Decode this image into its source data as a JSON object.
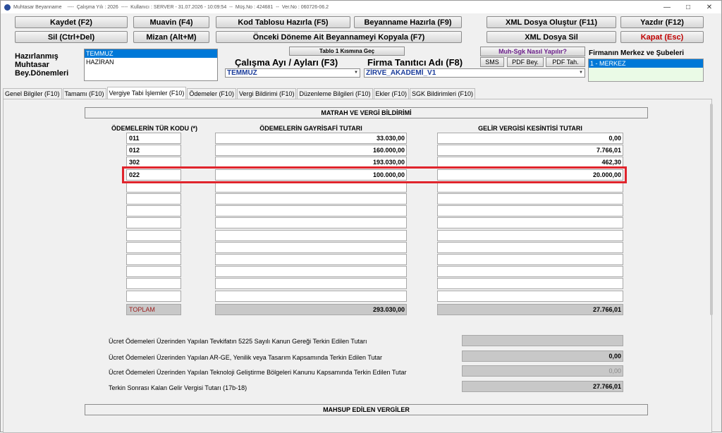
{
  "titlebar": {
    "title": "Muhtasar Beyanname",
    "calisma_yili": "Çalışma Yılı : 2026",
    "date": "Kullanıcı : SERVER - 31.07.2026 - 10:09:54",
    "musno": "Müş.No : 424681",
    "version": "Ver.No : 060726-06.2",
    "sep1": "----",
    "sep2": "----",
    "sep3": "--",
    "sep4": "--"
  },
  "toolbar": {
    "kaydet": "Kaydet (F2)",
    "muavin": "Muavin (F4)",
    "kod_tablosu": "Kod Tablosu Hazırla (F5)",
    "beyanname_hazirla": "Beyanname Hazırla (F9)",
    "xml_olustur": "XML Dosya Oluştur (F11)",
    "yazdir": "Yazdır (F12)",
    "sil": "Sil (Ctrl+Del)",
    "mizan": "Mizan (Alt+M)",
    "onceki_donem": "Önceki Döneme Ait Beyannameyi Kopyala (F7)",
    "xml_sil": "XML Dosya Sil",
    "kapat": "Kapat (Esc)"
  },
  "header": {
    "hazirlanmis_label": [
      "Hazırlanmış",
      "Muhtasar",
      "Bey.Dönemleri"
    ],
    "donemler": [
      "TEMMUZ",
      "HAZİRAN"
    ],
    "tablo1_button": "Tablo 1 Kısmına Geç",
    "calisma_ayi_label": "Çalışma Ayı / Ayları (F3)",
    "calisma_ayi_value": "TEMMUZ",
    "firma_label": "Firma Tanıtıcı Adı (F8)",
    "firma_value": "ZİRVE_AKADEMİ_V1",
    "muh_sgk_button": "Muh-Sgk Nasıl Yapılır?",
    "sms_button": "SMS",
    "pdf_bey_button": "PDF Bey.",
    "pdf_tah_button": "PDF Tah.",
    "merkez_label": "Firmanın Merkez ve Şubeleri",
    "merkez_items": [
      "1 - MERKEZ"
    ]
  },
  "tabs": [
    "Genel Bilgiler (F10)",
    "Tamamı (F10)",
    "Vergiye Tabi İşlemler (F10)",
    "Ödemeler (F10)",
    "Vergi Bildirimi (F10)",
    "Düzenleme Bilgileri (F10)",
    "Ekler (F10)",
    "SGK Bildirimleri (F10)"
  ],
  "active_tab": "Vergiye Tabi İşlemler (F10)",
  "matrah": {
    "section_title": "MATRAH VE VERGİ BİLDİRİMİ",
    "col_kod": "ÖDEMELERİN TÜR KODU (*)",
    "col_gayrisafi": "ÖDEMELERİN GAYRİSAFİ TUTARI",
    "col_kesinti": "GELİR VERGİSİ KESİNTİSİ TUTARI",
    "rows": [
      {
        "kod": "011",
        "gayrisafi": "33.030,00",
        "kesinti": "0,00"
      },
      {
        "kod": "012",
        "gayrisafi": "160.000,00",
        "kesinti": "7.766,01"
      },
      {
        "kod": "302",
        "gayrisafi": "193.030,00",
        "kesinti": "462,30"
      },
      {
        "kod": "022",
        "gayrisafi": "100.000,00",
        "kesinti": "20.000,00"
      },
      {
        "kod": "",
        "gayrisafi": "",
        "kesinti": ""
      },
      {
        "kod": "",
        "gayrisafi": "",
        "kesinti": ""
      },
      {
        "kod": "",
        "gayrisafi": "",
        "kesinti": ""
      },
      {
        "kod": "",
        "gayrisafi": "",
        "kesinti": ""
      },
      {
        "kod": "",
        "gayrisafi": "",
        "kesinti": ""
      },
      {
        "kod": "",
        "gayrisafi": "",
        "kesinti": ""
      },
      {
        "kod": "",
        "gayrisafi": "",
        "kesinti": ""
      },
      {
        "kod": "",
        "gayrisafi": "",
        "kesinti": ""
      },
      {
        "kod": "",
        "gayrisafi": "",
        "kesinti": ""
      },
      {
        "kod": "",
        "gayrisafi": "",
        "kesinti": ""
      }
    ],
    "highlighted_row": 3,
    "highlight_color": "#e0242c",
    "toplam_label": "TOPLAM",
    "toplam_gayrisafi": "293.030,00",
    "toplam_kesinti": "27.766,01"
  },
  "terkin": {
    "row1_label": "Ücret Ödemeleri Üzerinden Yapılan Tevkifatın 5225 Sayılı Kanun Gereği Terkin Edilen Tutarı",
    "row1_value": "",
    "row2_label": "Ücret Ödemeleri Üzerinden Yapılan AR-GE, Yenilik veya Tasarım Kapsamında Terkin Edilen Tutar",
    "row2_value": "0,00",
    "row3_label": "Ücret Ödemeleri Üzerinden Yapılan Teknoloji Geliştirme Bölgeleri Kanunu Kapsamında Terkin Edilen Tutar",
    "row3_value": "0,00",
    "row4_label": "Terkin Sonrası Kalan Gelir Vergisi Tutarı   (17b-18)",
    "row4_value": "27.766,01"
  },
  "mahsup": {
    "section_title": "MAHSUP EDİLEN VERGİLER"
  }
}
